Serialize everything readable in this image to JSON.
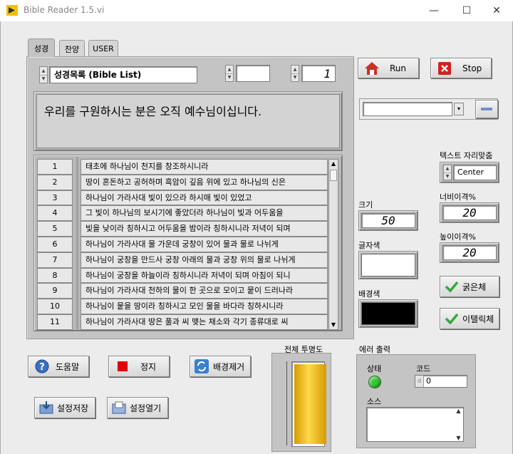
{
  "window": {
    "title": "Bible Reader 1.5.vi",
    "minimize": "—",
    "maximize": "☐",
    "close": "✕"
  },
  "tabs": [
    {
      "label": "성경"
    },
    {
      "label": "찬양"
    },
    {
      "label": "USER"
    }
  ],
  "bible_list": {
    "value": "성경목록 (Bible List)"
  },
  "chapter": {
    "value": ""
  },
  "verse": {
    "value": "1"
  },
  "display_text": "우리를 구원하시는 분은 오직 예수님이십니다.",
  "verses": [
    {
      "num": "1",
      "text": "태초에 하나님이 천지를 창조하시니라"
    },
    {
      "num": "2",
      "text": "땅이 혼돈하고 공허하며 흑암이 깊음 위에 있고 하나님의 신은"
    },
    {
      "num": "3",
      "text": "하나님이 가라사대 빛이 있으라 하시매 빛이 있었고"
    },
    {
      "num": "4",
      "text": "그 빛이 하나님의 보시기에 좋았더라 하나님이 빛과 어두움을"
    },
    {
      "num": "5",
      "text": "빛을 낮이라 칭하시고 어두움을 밤이라 칭하시니라 저녁이 되며"
    },
    {
      "num": "6",
      "text": "하나님이 가라사대 물 가운데 궁창이 있어 물과 물로 나뉘게"
    },
    {
      "num": "7",
      "text": "하나님이 궁창을 만드사 궁창 아래의 물과 궁창 위의 물로 나뉘게"
    },
    {
      "num": "8",
      "text": "하나님이 궁창을 하늘이라 칭하시니라 저녁이 되며 아침이 되니"
    },
    {
      "num": "9",
      "text": "하나님이 가라사대 천하의 물이 한 곳으로 모이고 뭍이 드러나라"
    },
    {
      "num": "10",
      "text": "하나님이 뭍을 땅이라 칭하시고 모인 물을 바다라 칭하시니라"
    },
    {
      "num": "11",
      "text": "하나님이 가라사대 땅은 풀과 씨 맺는 채소와 각기 종류대로 씨"
    }
  ],
  "controls": {
    "run": "Run",
    "stop": "Stop",
    "text_align_label": "텍스트 자리맞춤",
    "text_align_value": "Center",
    "size_label": "크기",
    "size_value": "50",
    "width_label": "너비이격%",
    "width_value": "20",
    "height_label": "높이이격%",
    "height_value": "20",
    "font_color_label": "글자색",
    "bg_color_label": "배경색",
    "bold": "굵은체",
    "italic": "이탤릭체"
  },
  "bottom_buttons": {
    "help": "도움말",
    "halt": "정지",
    "remove_bg": "배경제거",
    "save_settings": "설정저장",
    "open_settings": "설정열기"
  },
  "opacity": {
    "label": "전체 투명도",
    "level": 1.0
  },
  "error_out": {
    "label": "에러 출력",
    "status_label": "상태",
    "code_label": "코드",
    "code_value": "0",
    "code_prefix": "d",
    "source_label": "소스"
  },
  "colors": {
    "font_color": "#ffffff",
    "bg_color": "#000000",
    "status_ok": "#33cc33",
    "opacity_fill": "#f2b90d"
  }
}
